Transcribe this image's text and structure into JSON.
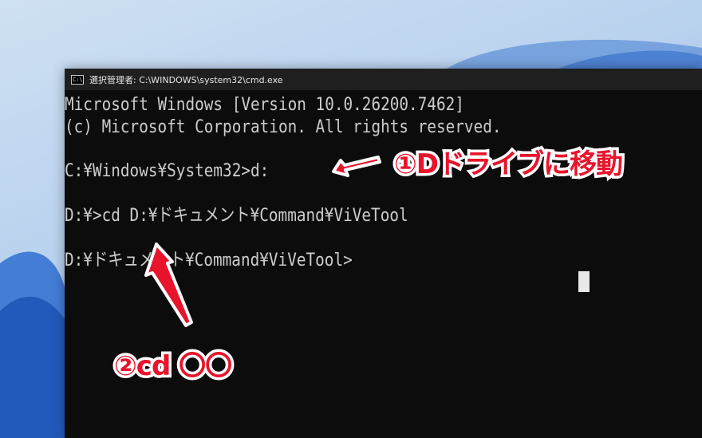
{
  "window": {
    "title": "選択管理者: C:\\WINDOWS\\system32\\cmd.exe",
    "icon": "cmd-icon",
    "icon_glyph": "C:\\"
  },
  "console": {
    "lines": [
      "Microsoft Windows [Version 10.0.26200.7462]",
      "(c) Microsoft Corporation. All rights reserved.",
      "",
      "C:¥Windows¥System32>d:",
      "",
      "D:¥>cd D:¥ドキュメント¥Command¥ViVeTool",
      "",
      "D:¥ドキュメント¥Command¥ViVeTool>"
    ]
  },
  "annotations": {
    "step1": "①Dドライブに移動",
    "step2": "②cd 〇〇"
  },
  "colors": {
    "console_bg": "#0c0c0c",
    "console_text": "#cccccc",
    "annotation_red": "#e8142c",
    "titlebar_bg": "#1f1f1f"
  }
}
